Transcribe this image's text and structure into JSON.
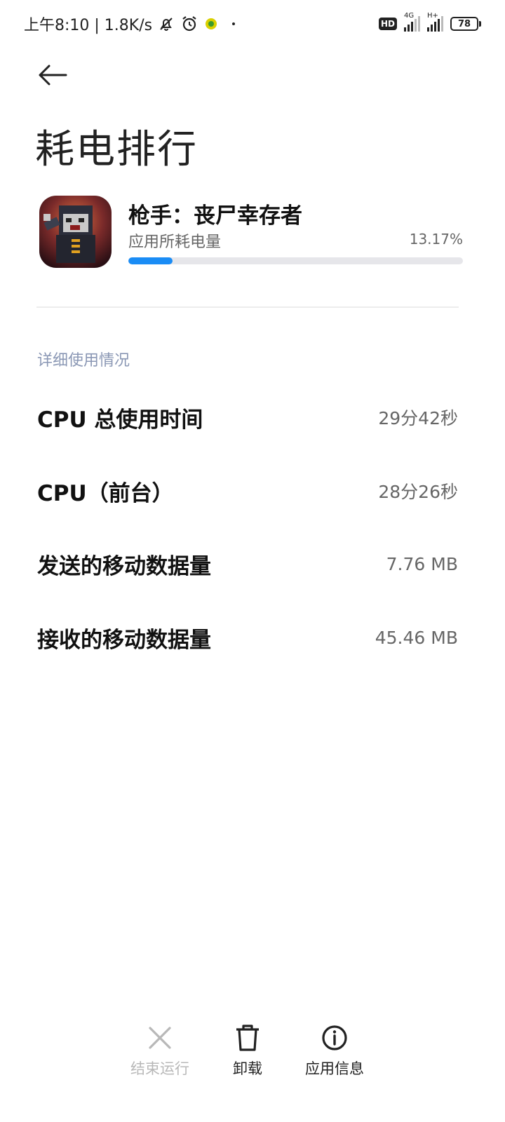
{
  "status_bar": {
    "time_and_speed": "上午8:10 | 1.8K/s",
    "hd_label": "HD",
    "network_1": "4G",
    "network_2": "H+",
    "battery_level": "78"
  },
  "header": {
    "title": "耗电排行"
  },
  "app": {
    "name": "枪手：丧尸幸存者",
    "usage_label": "应用所耗电量",
    "usage_percent": "13.17%",
    "usage_fraction": 0.1317
  },
  "details": {
    "section_label": "详细使用情况",
    "rows": [
      {
        "key": "CPU 总使用时间",
        "value": "29分42秒"
      },
      {
        "key": "CPU（前台）",
        "value": "28分26秒"
      },
      {
        "key": "发送的移动数据量",
        "value": "7.76 MB"
      },
      {
        "key": "接收的移动数据量",
        "value": "45.46 MB"
      }
    ]
  },
  "actions": {
    "stop": {
      "label": "结束运行",
      "icon": "close-icon",
      "enabled": false
    },
    "uninstall": {
      "label": "卸载",
      "icon": "trash-icon"
    },
    "app_info": {
      "label": "应用信息",
      "icon": "info-icon"
    }
  },
  "colors": {
    "accent": "#1a8cf5",
    "section_label": "#8a97b4"
  }
}
